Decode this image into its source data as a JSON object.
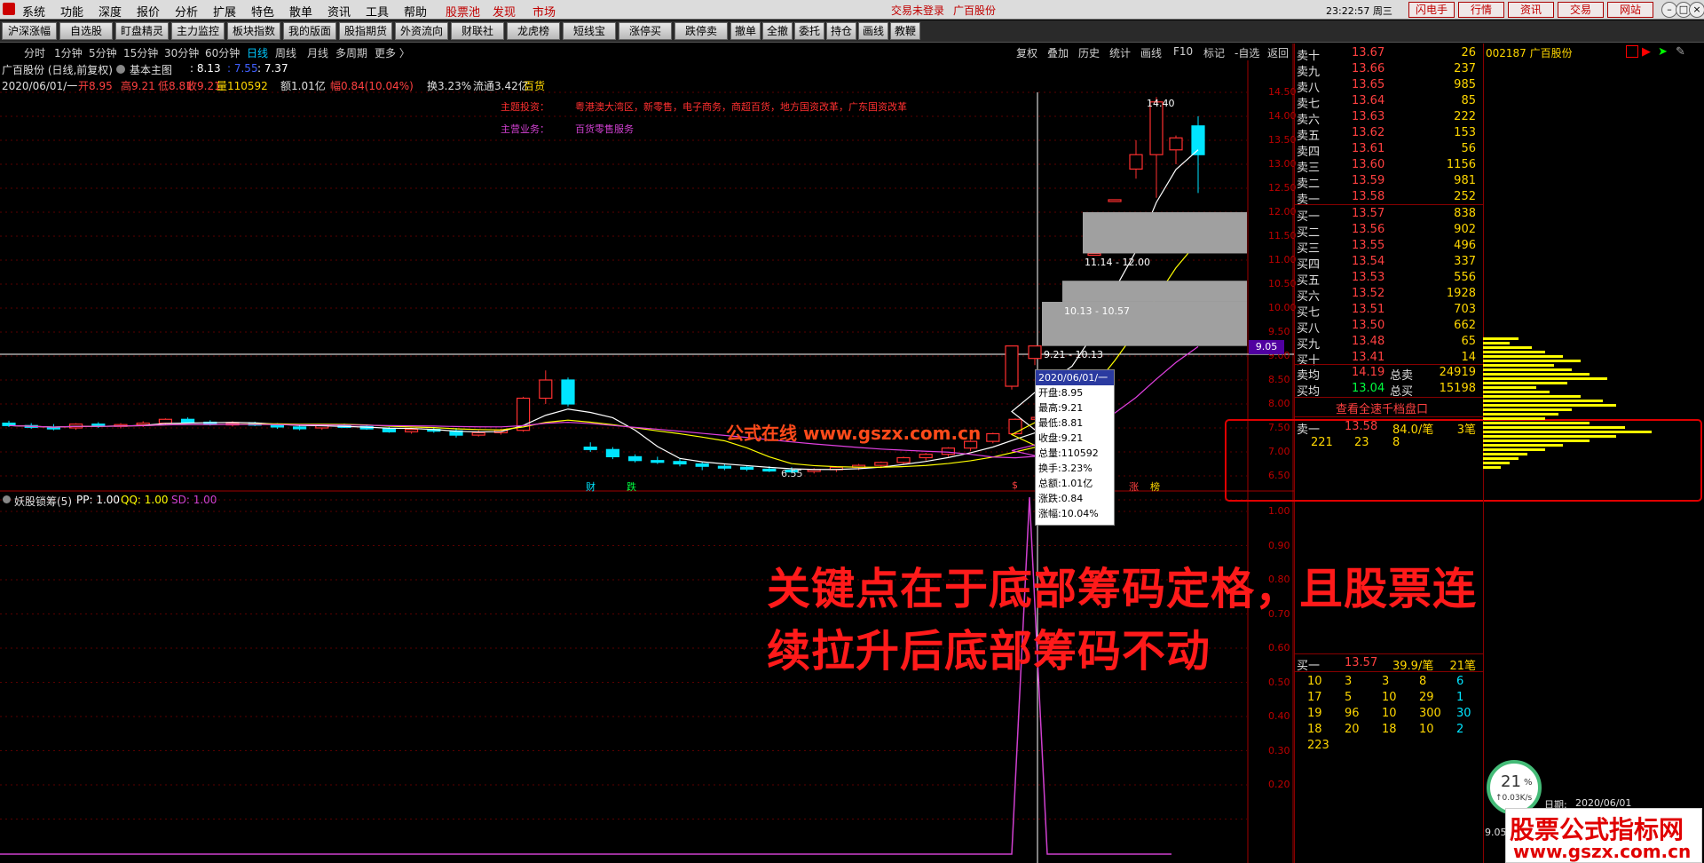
{
  "menubar": {
    "items": [
      "系统",
      "功能",
      "深度",
      "报价",
      "分析",
      "扩展",
      "特色",
      "散单",
      "资讯",
      "工具",
      "帮助"
    ],
    "red_items": [
      "股票池",
      "发现",
      "市场"
    ],
    "status": "交易未登录",
    "stock_name": "广百股份",
    "clock": "23:22:57 周三",
    "right_buttons": [
      "闪电手",
      "行情",
      "资讯",
      "交易",
      "网站"
    ]
  },
  "toolbar": {
    "buttons": [
      "沪深涨幅",
      "自选股",
      "盯盘精灵",
      "主力监控",
      "板块指数",
      "我的版面",
      "股指期货",
      "外资流向",
      "财联社",
      "龙虎榜",
      "短线宝",
      "涨停买",
      "跌停卖",
      "撤单",
      "全撤",
      "委托",
      "持仓",
      "画线",
      "教鞭"
    ]
  },
  "periods": {
    "items": [
      "分时",
      "1分钟",
      "5分钟",
      "15分钟",
      "30分钟",
      "60分钟",
      "日线",
      "周线",
      "月线",
      "多周期",
      "更多 〉"
    ],
    "selected": "日线",
    "right_items": [
      "复权",
      "叠加",
      "历史",
      "统计",
      "画线",
      "F10",
      "标记",
      "-自选",
      "返回"
    ]
  },
  "chart_header": {
    "title": "广百股份 (日线,前复权)",
    "indicator": "基本主图",
    "v1": ": 8.13",
    "v2": ": 7.55",
    "v3": ": 7.37"
  },
  "day_info": {
    "date": "2020/06/01/一",
    "open": "开8.95",
    "high": "高9.21",
    "low": "低8.81",
    "close": "收9.21",
    "volume": "量110592",
    "amount": "额1.01亿",
    "change": "幅0.84(10.04%)",
    "turnover": "换3.23%",
    "float": "流通3.42亿",
    "sector": "百货"
  },
  "theme": {
    "label1": "主题投资：",
    "value1": "粤港澳大湾区，新零售，电子商务，商超百货，地方国资改革，广东国资改革",
    "label2": "主营业务：",
    "value2": "百货零售服务"
  },
  "price_axis": [
    "14.50",
    "14.00",
    "13.50",
    "13.00",
    "12.50",
    "12.00",
    "11.50",
    "11.00",
    "10.50",
    "10.00",
    "9.50",
    "9.00",
    "8.50",
    "8.00",
    "7.50",
    "7.00",
    "6.50"
  ],
  "price_tag": "9.05",
  "chip_labels": {
    "high": "14.40",
    "band1": "11.14 - 12.00",
    "band2": "10.13 - 10.57",
    "band3": "9.21 - 10.13",
    "low": "6.55"
  },
  "markers": [
    "财",
    "跌",
    "$",
    "涨",
    "榜"
  ],
  "watermark": "公式在线  www.gszx.com.cn",
  "tooltip": {
    "date": "2020/06/01/一",
    "open": "开盘:8.95",
    "high": "最高:9.21",
    "low": "最低:8.81",
    "close": "收盘:9.21",
    "vol": "总量:110592",
    "turnover": "换手:3.23%",
    "amount": "总额:1.01亿",
    "chg": "涨跌:0.84",
    "pct": "涨幅:10.04%"
  },
  "sub_indicator": {
    "name": "妖股锁筹(5)",
    "pp": "PP: 1.00",
    "qq": "QQ: 1.00",
    "sd": "SD: 1.00",
    "axis": [
      "1.00",
      "0.90",
      "0.80",
      "0.70",
      "0.60",
      "0.50",
      "0.40",
      "0.30",
      "0.20"
    ]
  },
  "annotation": {
    "line1": "关键点在于底部筹码定格，且股票连",
    "line2": "续拉升后底部筹码不动"
  },
  "orderbook": {
    "code": "002187 广百股份",
    "sells": [
      {
        "l": "卖十",
        "p": "13.67",
        "q": "26"
      },
      {
        "l": "卖九",
        "p": "13.66",
        "q": "237"
      },
      {
        "l": "卖八",
        "p": "13.65",
        "q": "985"
      },
      {
        "l": "卖七",
        "p": "13.64",
        "q": "85"
      },
      {
        "l": "卖六",
        "p": "13.63",
        "q": "222"
      },
      {
        "l": "卖五",
        "p": "13.62",
        "q": "153"
      },
      {
        "l": "卖四",
        "p": "13.61",
        "q": "56"
      },
      {
        "l": "卖三",
        "p": "13.60",
        "q": "1156"
      },
      {
        "l": "卖二",
        "p": "13.59",
        "q": "981"
      },
      {
        "l": "卖一",
        "p": "13.58",
        "q": "252"
      }
    ],
    "buys": [
      {
        "l": "买一",
        "p": "13.57",
        "q": "838"
      },
      {
        "l": "买二",
        "p": "13.56",
        "q": "902"
      },
      {
        "l": "买三",
        "p": "13.55",
        "q": "496"
      },
      {
        "l": "买四",
        "p": "13.54",
        "q": "337"
      },
      {
        "l": "买五",
        "p": "13.53",
        "q": "556"
      },
      {
        "l": "买六",
        "p": "13.52",
        "q": "1928"
      },
      {
        "l": "买七",
        "p": "13.51",
        "q": "703"
      },
      {
        "l": "买八",
        "p": "13.50",
        "q": "662"
      },
      {
        "l": "买九",
        "p": "13.48",
        "q": "65"
      },
      {
        "l": "买十",
        "p": "13.41",
        "q": "14"
      }
    ],
    "avg_sell_label": "卖均",
    "avg_sell": "14.19",
    "total_sell_label": "总卖",
    "total_sell": "24919",
    "avg_buy_label": "买均",
    "avg_buy": "13.04",
    "total_buy_label": "总买",
    "total_buy": "15198",
    "full_depth": "查看全速千档盘口",
    "sell1_detail": {
      "label": "卖一",
      "price": "13.58",
      "avg": "84.0/笔",
      "count": "3笔",
      "vals": [
        "221",
        "23",
        "8"
      ]
    },
    "buy1_detail": {
      "label": "买一",
      "price": "13.57",
      "avg": "39.9/笔",
      "count": "21笔",
      "rows": [
        [
          "10",
          "3",
          "3",
          "8",
          "6"
        ],
        [
          "17",
          "5",
          "10",
          "29",
          "1"
        ],
        [
          "19",
          "96",
          "10",
          "300",
          "30"
        ],
        [
          "18",
          "20",
          "18",
          "10",
          "2"
        ],
        [
          "223",
          "",
          "",
          "",
          ""
        ]
      ]
    }
  },
  "right_panel": {
    "code": "002187 广百股份",
    "date_label": "日期:",
    "date": "2020/06/01",
    "net_speed": "↑0.03K/s",
    "percent": "21",
    "percent_unit": "%",
    "price_peek": "9.05"
  },
  "logo": {
    "line1": "股票公式指标网",
    "line2": "www.gszx.com.cn"
  },
  "colors": {
    "up": "#ff3030",
    "down": "#00e5ff",
    "panel_border": "#800000",
    "volume": "#ffff00"
  }
}
